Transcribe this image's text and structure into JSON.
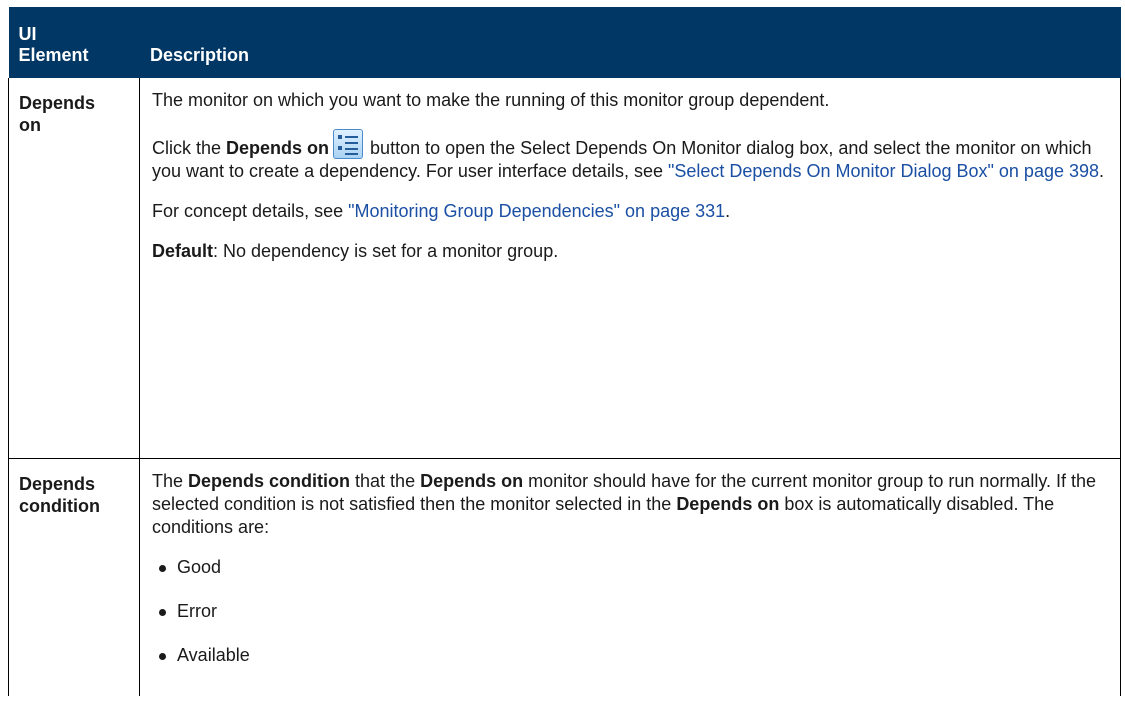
{
  "header": {
    "col1_line1": "UI",
    "col1_line2": "Element",
    "col2": "Description"
  },
  "rows": [
    {
      "element_line1": "Depends",
      "element_line2": "on",
      "p1": "The monitor on which you want to make the running of this monitor group dependent.",
      "p2_prefix": "Click the ",
      "p2_bold": "Depends on",
      "p2_icon": "depends-on-icon",
      "p2_mid": " button to open the Select Depends On Monitor dialog box, and select the monitor on which you want to create a dependency. For user interface details, see ",
      "p2_link": "\"Select Depends On Monitor Dialog Box\" on page 398",
      "p2_end": ".",
      "p3_prefix": "For concept details, see ",
      "p3_link": "\"Monitoring Group Dependencies\" on page 331",
      "p3_end": ".",
      "p4_bold": "Default",
      "p4_rest": ": No dependency is set for a monitor group."
    },
    {
      "element_line1": "Depends",
      "element_line2": "condition",
      "p1_a": "The ",
      "p1_b": "Depends condition",
      "p1_c": " that the ",
      "p1_d": "Depends on",
      "p1_e": " monitor should have for the current monitor group to run normally. If the selected condition is not satisfied then the monitor selected in the ",
      "p1_f": "Depends on",
      "p1_g": " box is automatically disabled. The conditions are:",
      "conditions": [
        "Good",
        "Error",
        "Available"
      ]
    }
  ],
  "colors": {
    "header_bg": "#003764",
    "link": "#1a4fa3"
  }
}
